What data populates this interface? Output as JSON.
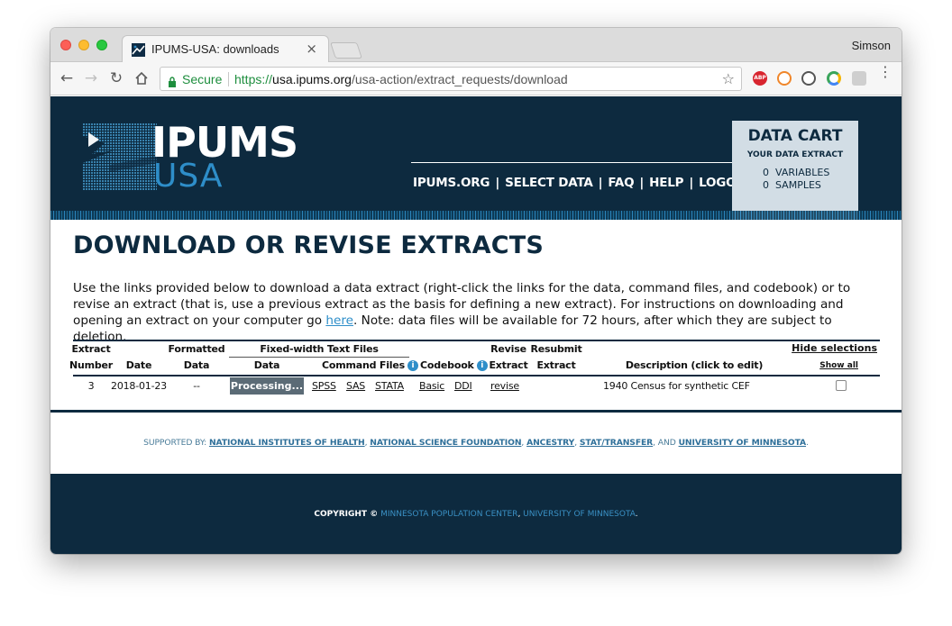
{
  "browser": {
    "tab_title": "IPUMS-USA: downloads",
    "tab_close": "×",
    "profile_name": "Simson",
    "secure_label": "Secure",
    "url_scheme": "https://",
    "url_host": "usa.ipums.org",
    "url_path": "/usa-action/extract_requests/download",
    "extensions": [
      "abp-icon",
      "b-icon",
      "info-icon",
      "chart-icon",
      "gray-icon"
    ],
    "abp_label": "ABP"
  },
  "header": {
    "logo_top": "IPUMS",
    "logo_bottom": "USA",
    "nav": [
      "IPUMS.ORG",
      "SELECT DATA",
      "FAQ",
      "HELP",
      "LOGOUT"
    ],
    "nav_separator": "|",
    "cart_title": "DATA CART",
    "cart_subtitle": "YOUR DATA EXTRACT",
    "cart_variables_count": "0",
    "cart_variables_label": "VARIABLES",
    "cart_samples_count": "0",
    "cart_samples_label": "SAMPLES"
  },
  "main": {
    "title": "DOWNLOAD OR REVISE EXTRACTS",
    "intro_before": "Use the links provided below to download a data extract (right-click the links for the data, command files, and codebook) or to revise an extract (that is, use a previous extract as the basis for defining a new extract). For instructions on downloading and opening an extract on your computer go ",
    "intro_link": "here",
    "intro_after": ". Note: data files will be available for 72 hours, after which they are subject to deletion."
  },
  "table": {
    "headers": {
      "extract": "Extract",
      "number": "Number",
      "date": "Date",
      "formatted": "Formatted",
      "formatted_data": "Data",
      "fixed_width": "Fixed-width Text Files",
      "fw_data": "Data",
      "command_files": "Command Files",
      "codebook": "Codebook",
      "revise": "Revise",
      "revise_extract": "Extract",
      "resubmit": "Resubmit",
      "resubmit_extract": "Extract",
      "description": "Description (click to edit)",
      "hide_selections": "Hide selections",
      "show_all": "Show all",
      "info_glyph": "i"
    },
    "row": {
      "number": "3",
      "date": "2018-01-23",
      "formatted_data": "--",
      "data_status": "Processing...",
      "spss": "SPSS",
      "sas": "SAS",
      "stata": "STATA",
      "codebook_basic": "Basic",
      "codebook_ddi": "DDI",
      "revise": "revise",
      "description": "1940 Census for synthetic CEF",
      "selected": false
    }
  },
  "footer": {
    "supported_by": "SUPPORTED BY:",
    "nih": "NATIONAL INSTITUTES OF HEALTH",
    "nsf": "NATIONAL SCIENCE FOUNDATION",
    "ancestry": "ANCESTRY",
    "stat_transfer": "STAT/TRANSFER",
    "and_text": ", AND",
    "umn": "UNIVERSITY OF MINNESOTA",
    "copyright_prefix": "COPYRIGHT ©",
    "mpc": "MINNESOTA POPULATION CENTER",
    "umn_copyright": "UNIVERSITY OF MINNESOTA"
  }
}
